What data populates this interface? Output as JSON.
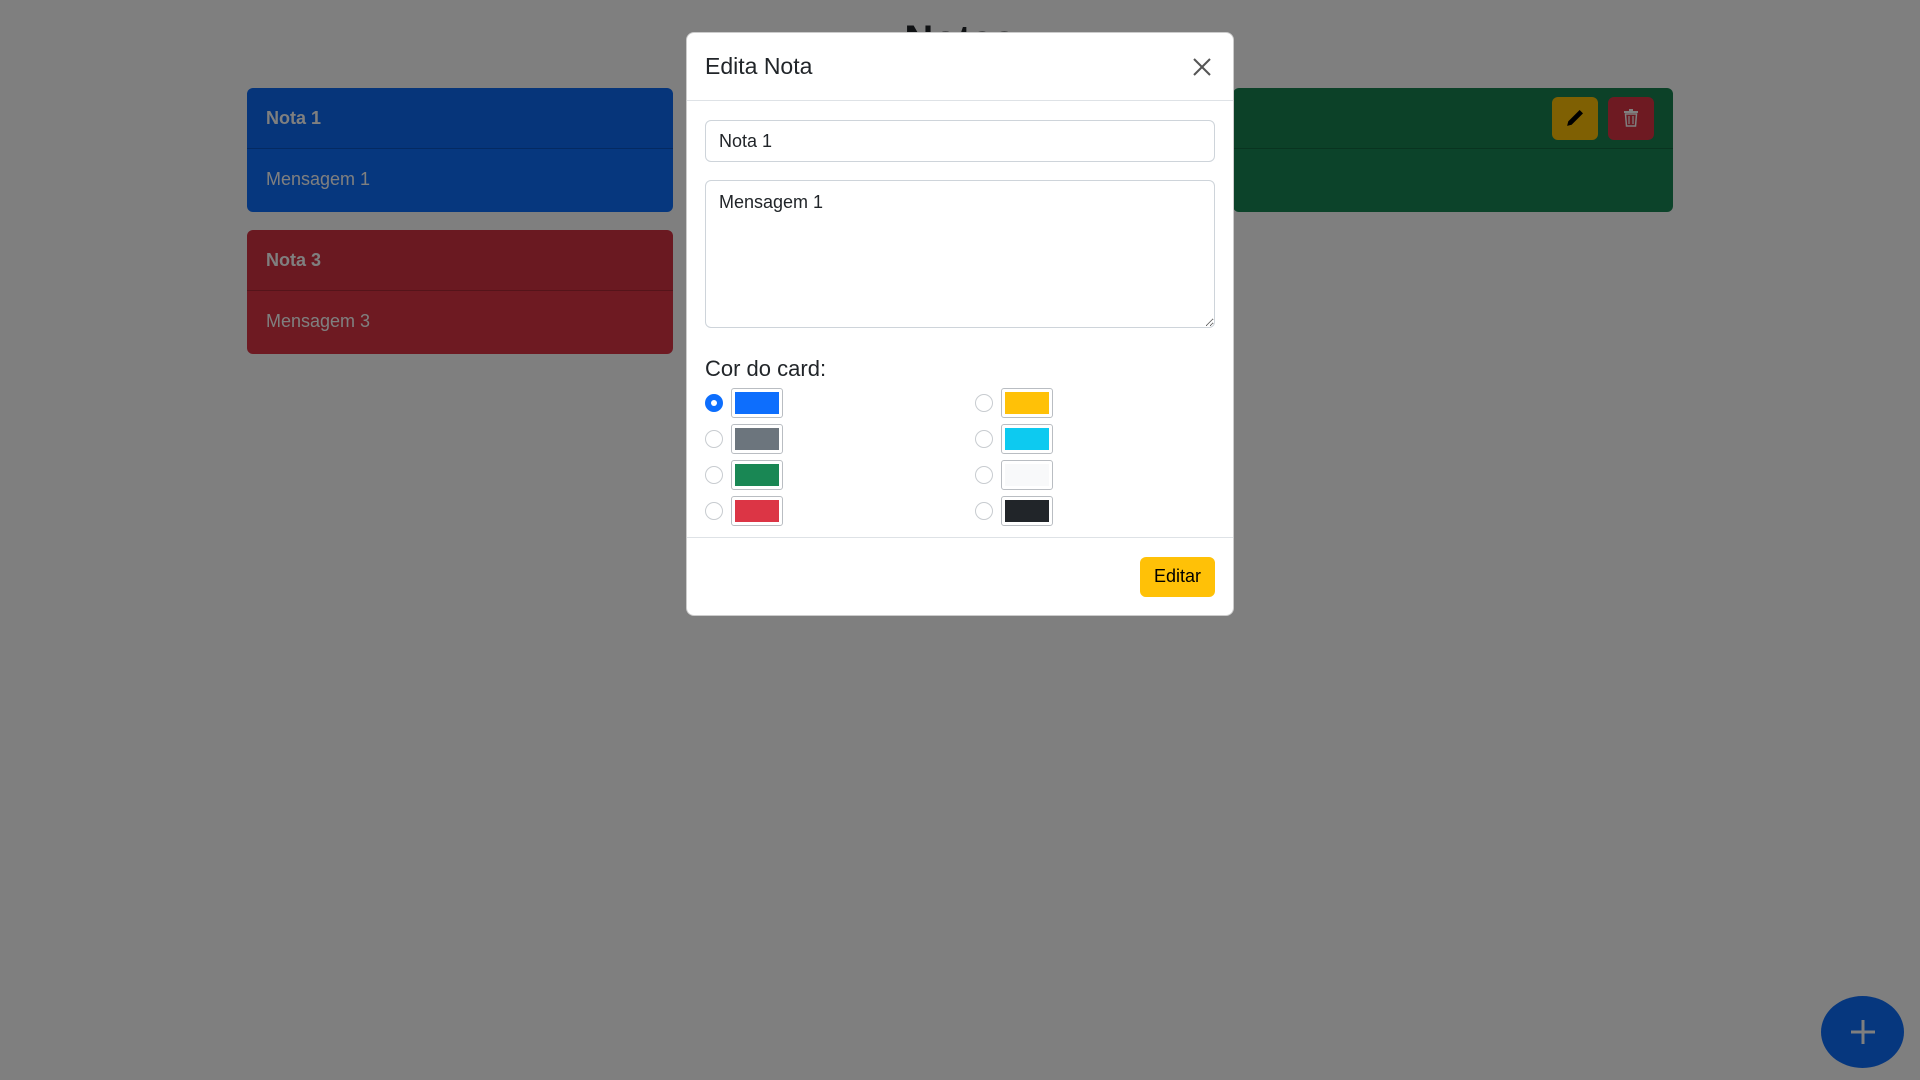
{
  "page": {
    "title": "Notas",
    "fab_icon": "plus-icon"
  },
  "notes": [
    {
      "title": "Nota 1",
      "message": "Mensagem 1",
      "color": "#0d6efd",
      "edit_icon": "pencil-icon",
      "delete_icon": "trash-icon"
    },
    {
      "title": "Nota 3",
      "message": "Mensagem 3",
      "color": "#dc3545"
    }
  ],
  "hidden_note": {
    "color": "#198754"
  },
  "modal": {
    "title": "Edita Nota",
    "close_icon": "close-icon",
    "title_value": "Nota 1",
    "message_value": "Mensagem 1",
    "color_label": "Cor do card:",
    "color_options": [
      {
        "color": "#0d6efd",
        "selected": true
      },
      {
        "color": "#ffc107",
        "selected": false
      },
      {
        "color": "#6c757d",
        "selected": false
      },
      {
        "color": "#0dcaf0",
        "selected": false
      },
      {
        "color": "#198754",
        "selected": false
      },
      {
        "color": "#f8f9fa",
        "selected": false
      },
      {
        "color": "#dc3545",
        "selected": false
      },
      {
        "color": "#212529",
        "selected": false
      }
    ],
    "submit_label": "Editar"
  }
}
